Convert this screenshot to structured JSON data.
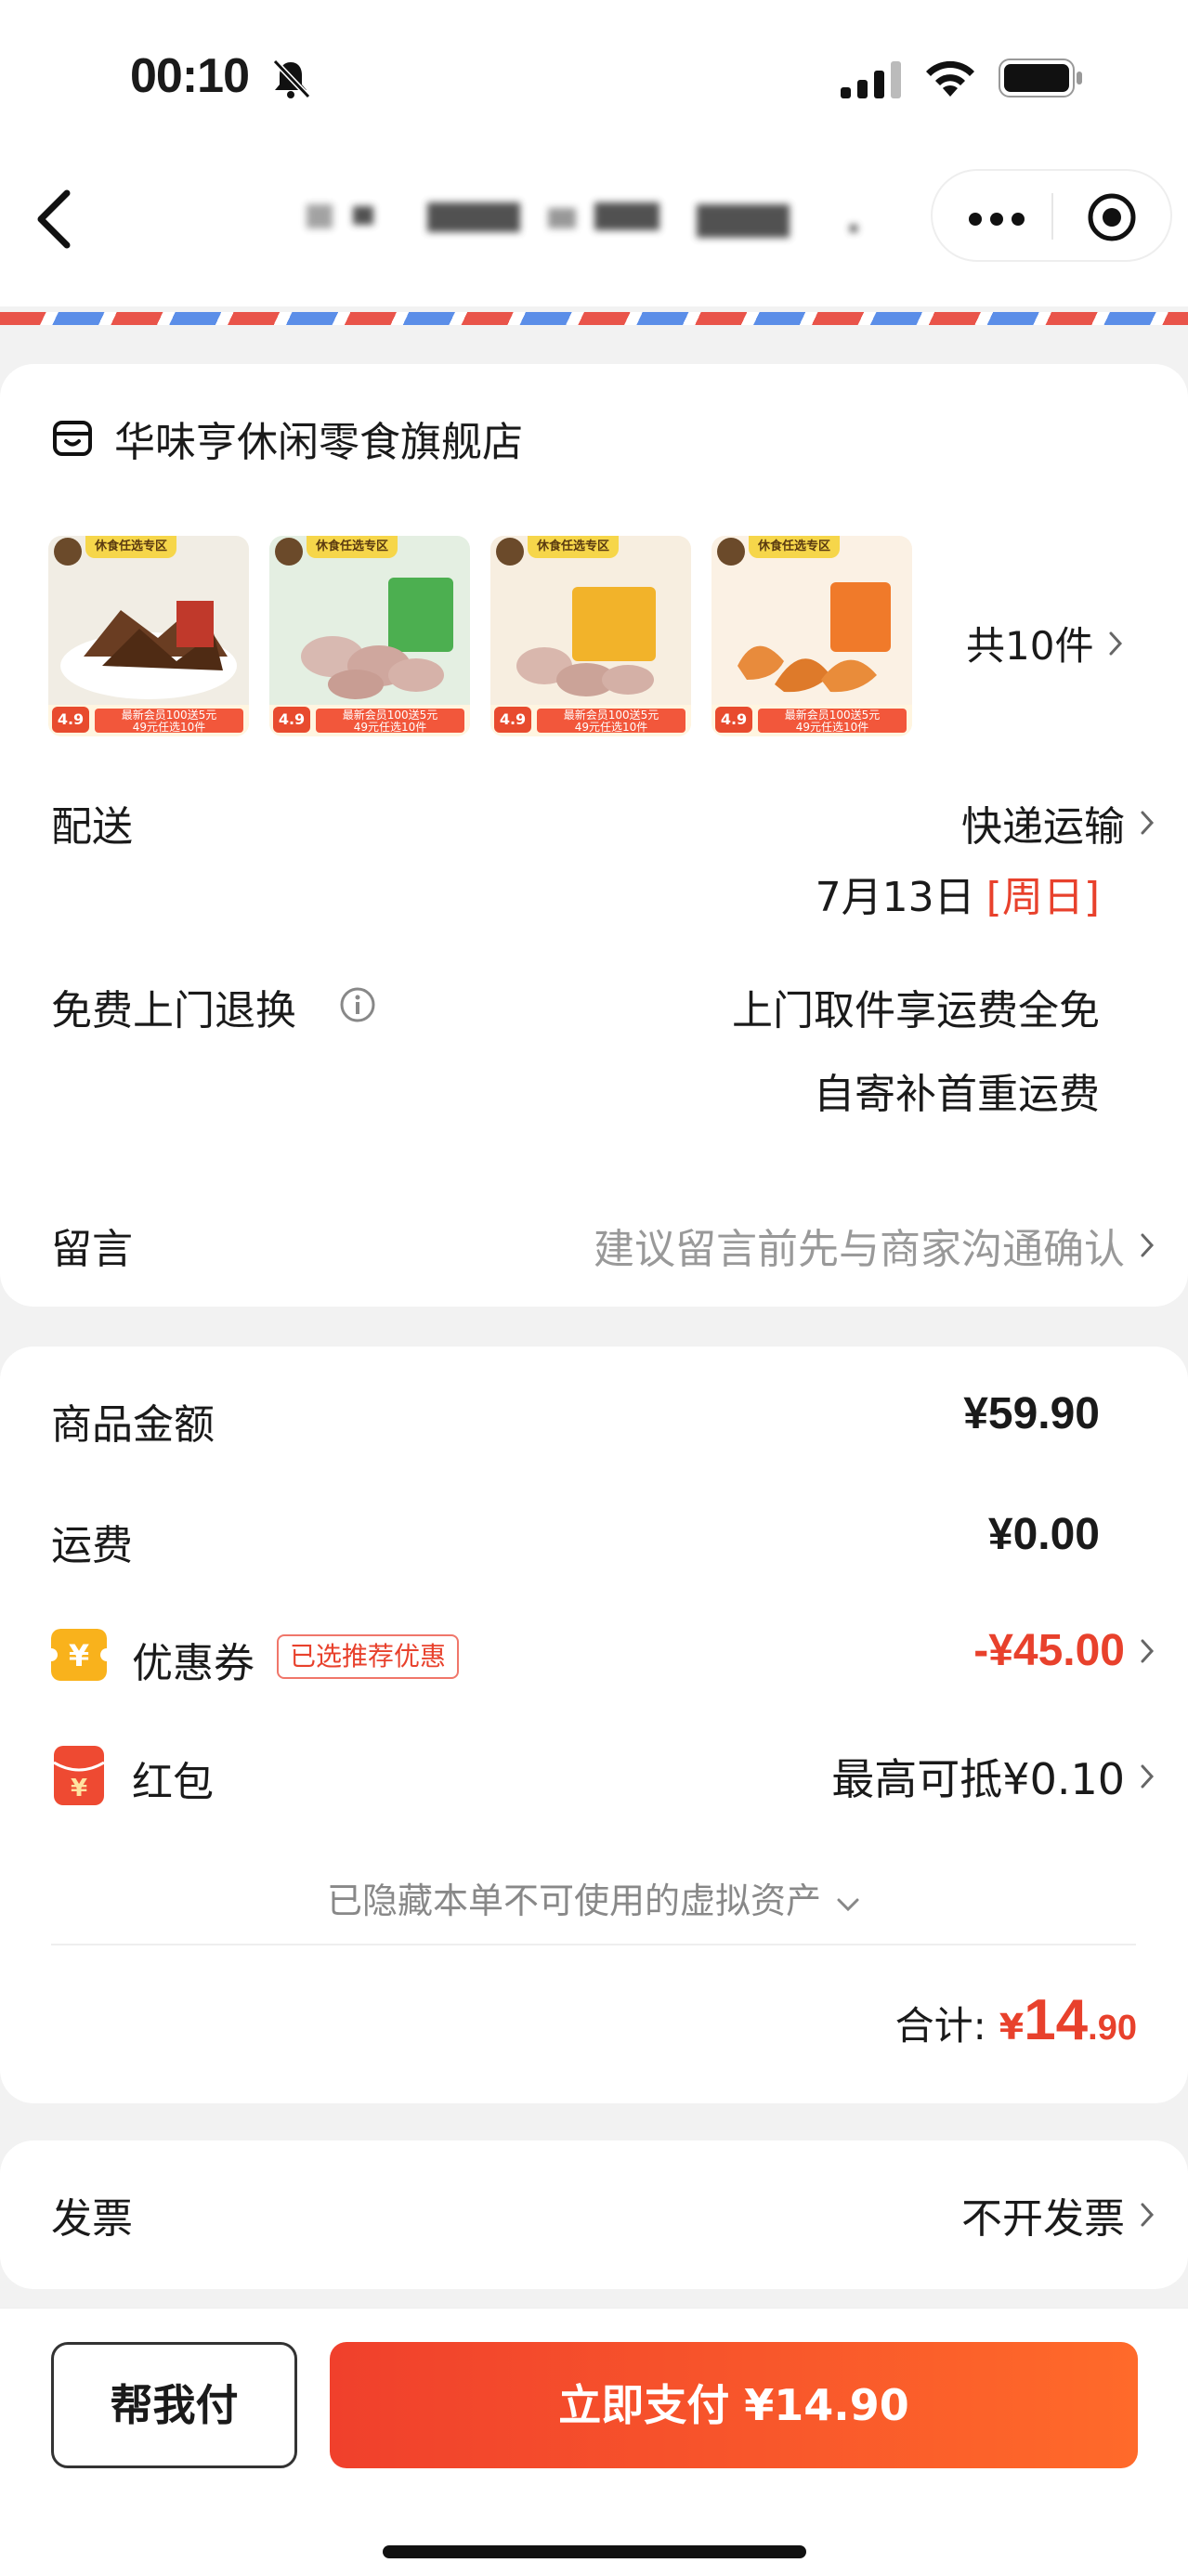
{
  "status_bar": {
    "time": "00:10"
  },
  "shop": {
    "name": "华味亨休闲零食旗舰店"
  },
  "products": {
    "count_label": "共10件",
    "thumb_tag": "休食任选专区",
    "thumb_price": "4.9",
    "thumb_promo_line1": "最新会员100送5元",
    "thumb_promo_line2": "49元任选10件"
  },
  "delivery": {
    "label": "配送",
    "method": "快递运输",
    "date": "7月13日",
    "weekday": "[周日]"
  },
  "return_service": {
    "label": "免费上门退换",
    "line1": "上门取件享运费全免",
    "line2": "自寄补首重运费"
  },
  "message": {
    "label": "留言",
    "placeholder": "建议留言前先与商家沟通确认"
  },
  "pricing": {
    "goods_label": "商品金额",
    "goods_value": "¥59.90",
    "shipping_label": "运费",
    "shipping_value": "¥0.00",
    "coupon_label": "优惠券",
    "coupon_badge": "已选推荐优惠",
    "coupon_value": "-¥45.00",
    "redpacket_label": "红包",
    "redpacket_value": "最高可抵¥0.10",
    "hidden_assets": "已隐藏本单不可使用的虚拟资产",
    "total_label": "合计:",
    "total_currency": "¥",
    "total_int": "14",
    "total_dec": ".90"
  },
  "invoice": {
    "label": "发票",
    "value": "不开发票"
  },
  "actions": {
    "help_pay": "帮我付",
    "pay_now": "立即支付 ¥14.90"
  },
  "colors": {
    "accent": "#e8412c",
    "pay_gradient_start": "#f0402c",
    "pay_gradient_end": "#ff6a2a"
  }
}
